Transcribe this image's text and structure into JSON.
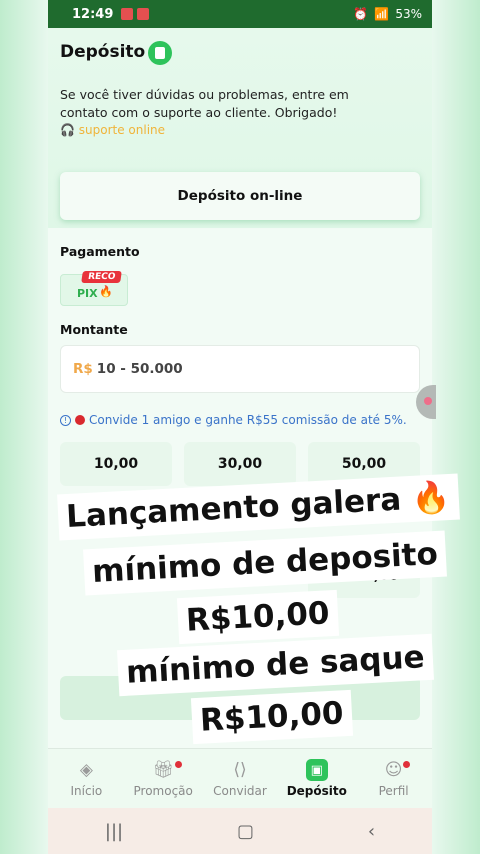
{
  "status_bar": {
    "time": "12:49",
    "battery": "53%"
  },
  "header": {
    "title": "Depósito"
  },
  "notice": {
    "text": "Se você tiver dúvidas ou problemas, entre em contato com o suporte ao cliente. Obrigado!",
    "support_link": "suporte online"
  },
  "online_button": {
    "label": "Depósito on-line"
  },
  "payment": {
    "label": "Pagamento",
    "method": "PIX",
    "badge": "RECO"
  },
  "amount": {
    "label": "Montante",
    "currency": "R$",
    "placeholder": "10 - 50.000"
  },
  "invite": {
    "text": "Convide 1 amigo e ganhe R$55 comissão de até 5%."
  },
  "amount_options": [
    "10,00",
    "30,00",
    "50,00",
    "5.000,00"
  ],
  "overlay": {
    "line1": "Lançamento galera 🔥",
    "line2": "mínimo de deposito",
    "line3": "R$10,00",
    "line4": "mínimo de saque",
    "line5": "R$10,00"
  },
  "tabs": [
    {
      "label": "Início",
      "icon": "home-icon"
    },
    {
      "label": "Promoção",
      "icon": "gift-icon"
    },
    {
      "label": "Convidar",
      "icon": "share-icon"
    },
    {
      "label": "Depósito",
      "icon": "wallet-icon"
    },
    {
      "label": "Perfil",
      "icon": "profile-icon"
    }
  ],
  "colors": {
    "accent": "#2ec35b",
    "status_bar": "#1f6b2e",
    "link": "#3a73c9"
  }
}
